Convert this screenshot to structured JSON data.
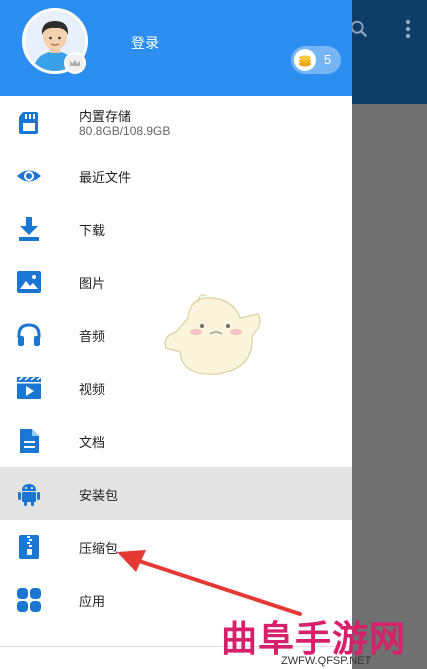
{
  "header": {
    "login_label": "登录",
    "coin_count": "5"
  },
  "menu": [
    {
      "label": "内置存储",
      "sub": "80.8GB/108.9GB",
      "icon": "sd-card-icon"
    },
    {
      "label": "最近文件",
      "icon": "eye-icon"
    },
    {
      "label": "下载",
      "icon": "download-icon"
    },
    {
      "label": "图片",
      "icon": "image-icon"
    },
    {
      "label": "音频",
      "icon": "headphones-icon"
    },
    {
      "label": "视频",
      "icon": "video-icon"
    },
    {
      "label": "文档",
      "icon": "document-icon"
    },
    {
      "label": "安装包",
      "icon": "android-icon",
      "selected": true
    },
    {
      "label": "压缩包",
      "icon": "zip-icon"
    },
    {
      "label": "应用",
      "icon": "apps-icon"
    }
  ],
  "watermark": {
    "title": "曲阜手游网",
    "url": "ZWFW.QFSP.NET"
  },
  "colors": {
    "accent": "#2c8ef0",
    "icon": "#1976d2",
    "toolbar_bg": "#0c3c68",
    "arrow": "#e53935",
    "watermark": "#d6206b"
  }
}
